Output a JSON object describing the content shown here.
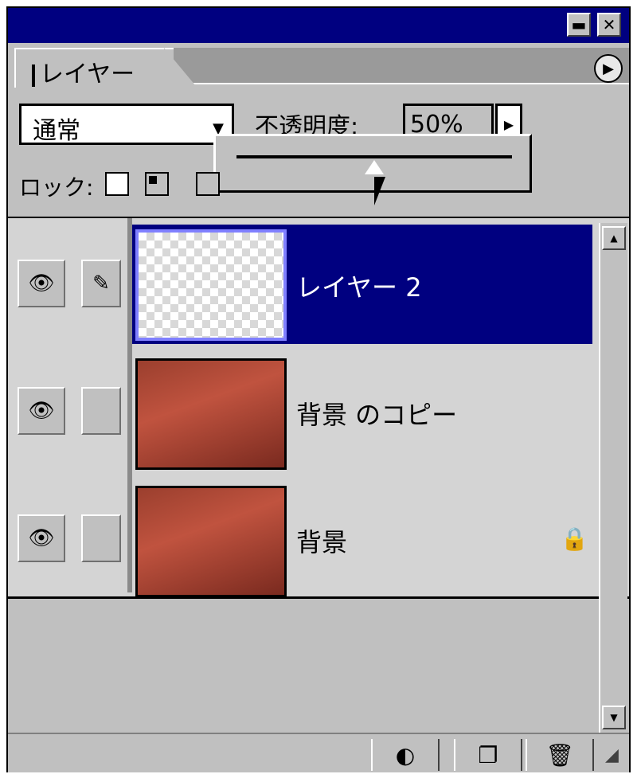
{
  "window": {
    "minimize_icon": "minimize-icon",
    "close_icon": "close-icon"
  },
  "tab": {
    "label": "レイヤー",
    "menu_icon": "panel-menu-arrow-icon"
  },
  "options": {
    "blend_mode": "通常",
    "opacity_label": "不透明度:",
    "opacity_value": "50%",
    "opacity_percent": 50
  },
  "lock": {
    "label": "ロック:",
    "options_icons": [
      "lock-transparency-icon",
      "lock-image-icon",
      "lock-position-icon"
    ]
  },
  "layers": [
    {
      "name": "レイヤー 2",
      "selected": true,
      "visible": true,
      "thumbnail": "transparent",
      "locked": false
    },
    {
      "name": "背景 のコピー",
      "selected": false,
      "visible": true,
      "thumbnail": "photo",
      "locked": false
    },
    {
      "name": "背景",
      "selected": false,
      "visible": true,
      "thumbnail": "photo",
      "locked": true
    }
  ],
  "bottom_buttons": [
    "new-fill-adjustment-layer-icon",
    "new-layer-icon",
    "trash-icon"
  ],
  "colors": {
    "titlebar": "#000080",
    "selection": "#000080",
    "panel": "#c0c0c0"
  }
}
